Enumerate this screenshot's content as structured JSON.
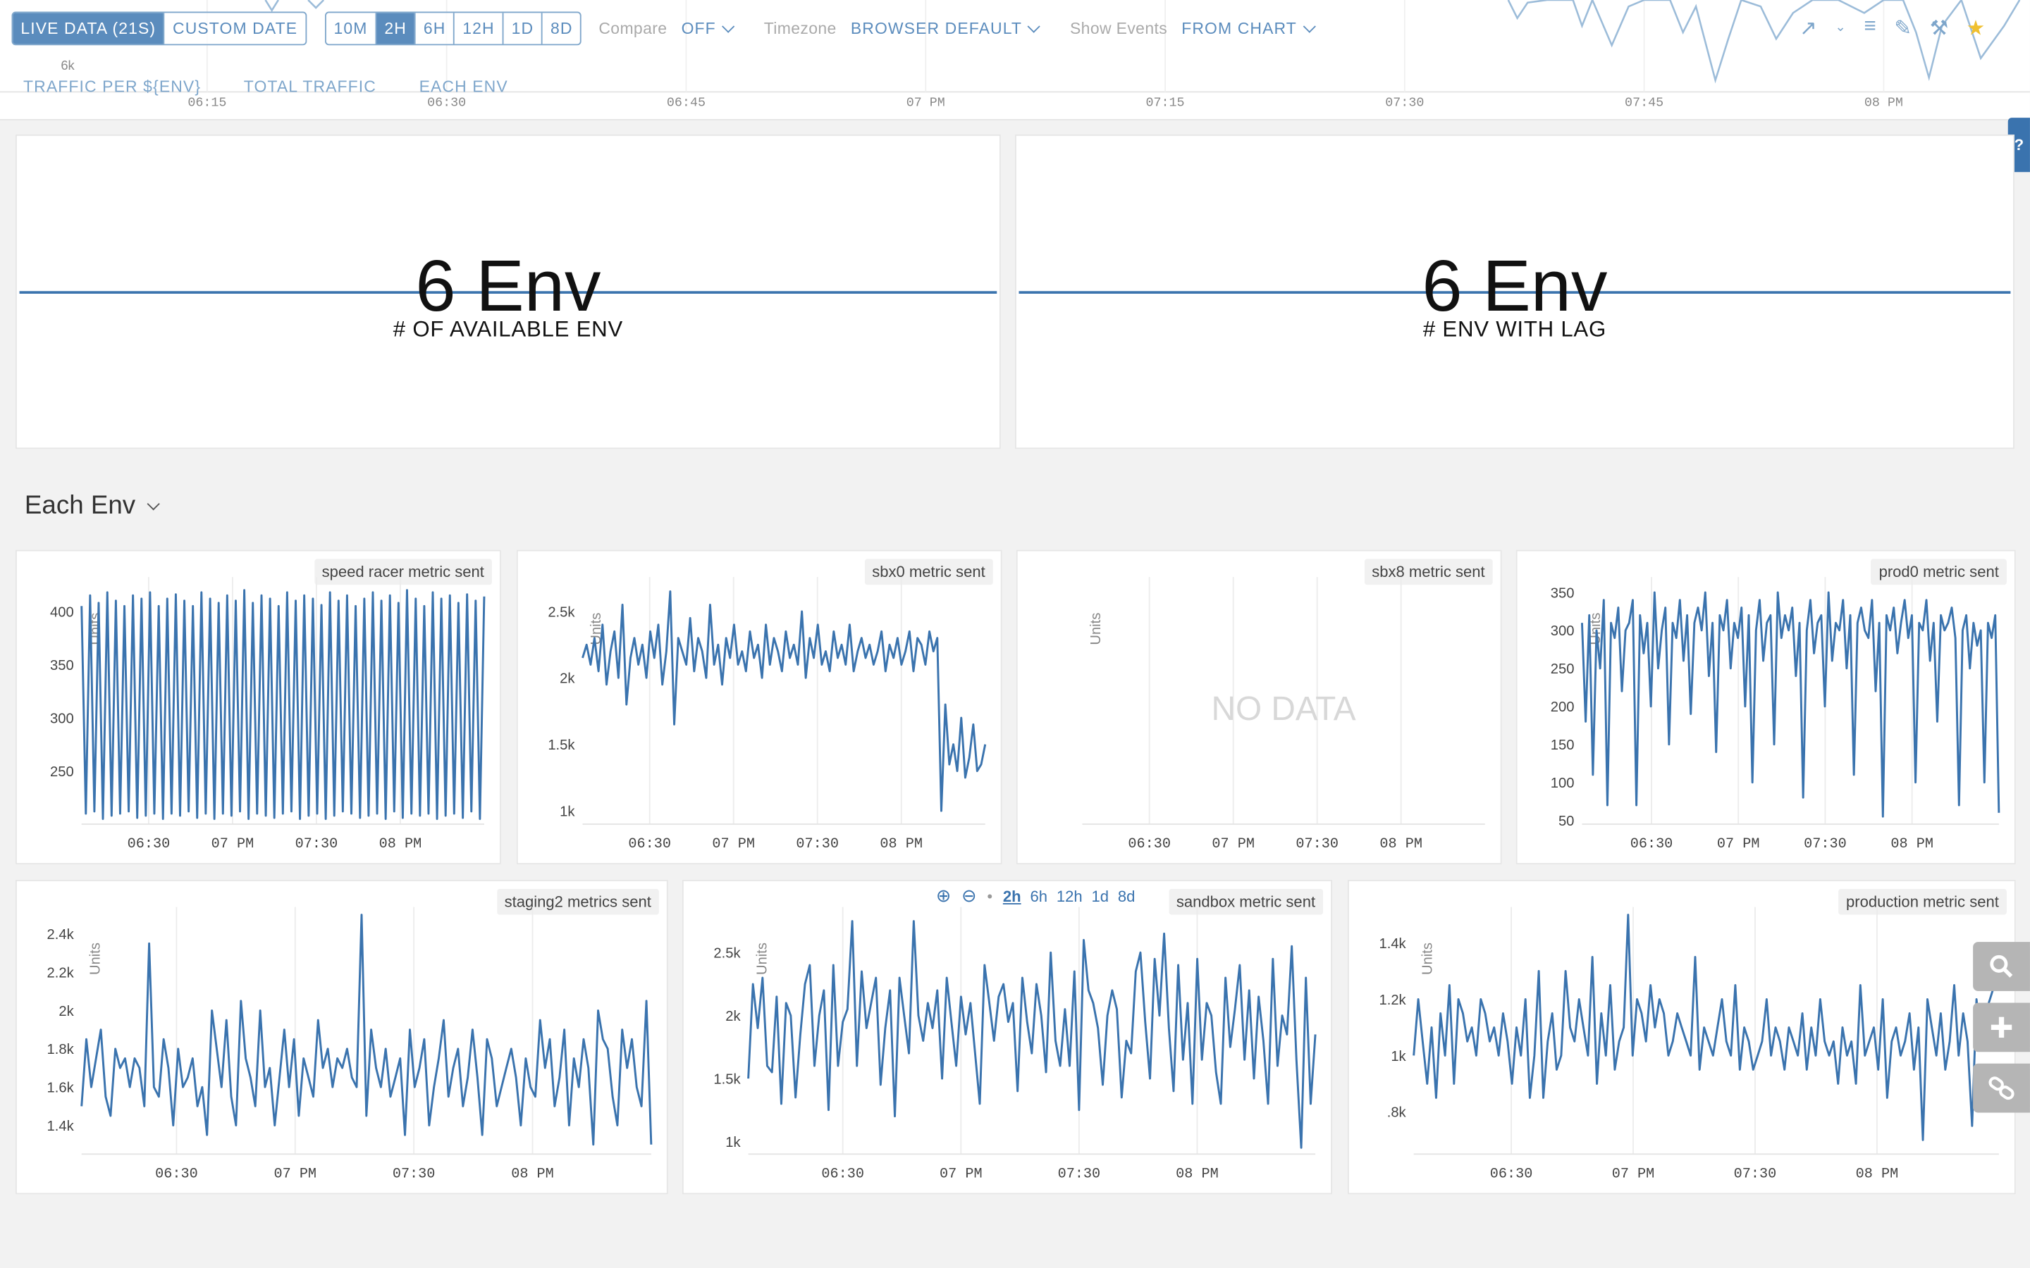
{
  "toolbar": {
    "live_label": "LIVE DATA (21S)",
    "custom_date_label": "CUSTOM DATE",
    "ranges": [
      "10M",
      "2H",
      "6H",
      "12H",
      "1D",
      "8D"
    ],
    "active_range": "2H",
    "compare_label": "Compare",
    "compare_value": "OFF",
    "timezone_label": "Timezone",
    "timezone_value": "BROWSER DEFAULT",
    "events_label": "Show Events",
    "events_value": "FROM CHART"
  },
  "links": [
    "TRAFFIC PER ${ENV}",
    "TOTAL TRAFFIC",
    "EACH ENV"
  ],
  "top_chart": {
    "ytick": "6k",
    "xticks": [
      "06:15",
      "06:30",
      "06:45",
      "07 PM",
      "07:15",
      "07:30",
      "07:45",
      "08 PM"
    ]
  },
  "help_label": "?",
  "stats": [
    {
      "value": "6 Env",
      "label": "# OF AVAILABLE ENV"
    },
    {
      "value": "6 Env",
      "label": "# ENV WITH LAG"
    }
  ],
  "section_title": "Each Env",
  "zoom": {
    "ranges": [
      "2h",
      "6h",
      "12h",
      "1d",
      "8d"
    ],
    "active": "2h"
  },
  "colors": {
    "series": "#3a73ae",
    "accent": "#5b8cbd",
    "grid": "#e8e8e8"
  },
  "chart_data": [
    {
      "type": "line",
      "title": "speed racer metric sent",
      "ylabel": "Units",
      "yticks": [
        {
          "v": 250,
          "t": "250"
        },
        {
          "v": 300,
          "t": "300"
        },
        {
          "v": 350,
          "t": "350"
        },
        {
          "v": 400,
          "t": "400"
        }
      ],
      "ylim": [
        200,
        425
      ],
      "xticks": [
        "06:30",
        "07 PM",
        "07:30",
        "08 PM"
      ],
      "xlim": [
        0,
        120
      ],
      "xtick_pos": [
        20,
        45,
        70,
        95
      ],
      "values": [
        405,
        210,
        415,
        212,
        408,
        205,
        418,
        208,
        410,
        210,
        405,
        212,
        415,
        206,
        412,
        208,
        418,
        210,
        405,
        205,
        412,
        210,
        416,
        208,
        410,
        212,
        405,
        206,
        418,
        210,
        412,
        205,
        408,
        210,
        415,
        208,
        410,
        212,
        420,
        205,
        408,
        210,
        415,
        208,
        412,
        206,
        405,
        210,
        418,
        212,
        410,
        205,
        415,
        208,
        412,
        210,
        406,
        205,
        418,
        208,
        410,
        212,
        415,
        210,
        405,
        206,
        412,
        208,
        418,
        210,
        410,
        205,
        415,
        212,
        408,
        206,
        420,
        210,
        412,
        208,
        405,
        210,
        418,
        205,
        412,
        208,
        415,
        210,
        408,
        206,
        416,
        212,
        410,
        205,
        414
      ],
      "no_data": false
    },
    {
      "type": "line",
      "title": "sbx0 metric sent",
      "ylabel": "Units",
      "yticks": [
        {
          "v": 1000,
          "t": "1k"
        },
        {
          "v": 1500,
          "t": "1.5k"
        },
        {
          "v": 2000,
          "t": "2k"
        },
        {
          "v": 2500,
          "t": "2.5k"
        }
      ],
      "ylim": [
        900,
        2700
      ],
      "xticks": [
        "06:30",
        "07 PM",
        "07:30",
        "08 PM"
      ],
      "xlim": [
        0,
        120
      ],
      "xtick_pos": [
        20,
        45,
        70,
        95
      ],
      "values": [
        2150,
        2250,
        2100,
        2300,
        2050,
        2400,
        1950,
        2200,
        2350,
        2000,
        2550,
        1800,
        2150,
        2300,
        2100,
        2250,
        2000,
        2350,
        2150,
        2400,
        1950,
        2200,
        2650,
        1650,
        2300,
        2200,
        2100,
        2450,
        2050,
        2300,
        2200,
        2000,
        2550,
        2100,
        2250,
        1950,
        2300,
        2150,
        2400,
        2100,
        2200,
        2050,
        2350,
        2150,
        2250,
        2000,
        2400,
        2100,
        2300,
        2200,
        2050,
        2350,
        2150,
        2250,
        2100,
        2500,
        2000,
        2300,
        2150,
        2400,
        2100,
        2200,
        2050,
        2350,
        2150,
        2250,
        2100,
        2400,
        2050,
        2200,
        2300,
        2150,
        2250,
        2100,
        2200,
        2350,
        2050,
        2250,
        2150,
        2300,
        2100,
        2200,
        2350,
        2050,
        2300,
        2250,
        2100,
        2350,
        2200,
        2300,
        1000,
        1800,
        1350,
        1500,
        1300,
        1700,
        1250,
        1400,
        1650,
        1300,
        1350,
        1500
      ],
      "no_data": false
    },
    {
      "type": "line",
      "title": "sbx8 metric sent",
      "ylabel": "Units",
      "yticks": [],
      "ylim": [
        0,
        1
      ],
      "xticks": [
        "06:30",
        "07 PM",
        "07:30",
        "08 PM"
      ],
      "xlim": [
        0,
        120
      ],
      "xtick_pos": [
        20,
        45,
        70,
        95
      ],
      "values": [],
      "no_data": true,
      "no_data_label": "NO DATA"
    },
    {
      "type": "line",
      "title": "prod0 metric sent",
      "ylabel": "Units",
      "yticks": [
        {
          "v": 50,
          "t": "50"
        },
        {
          "v": 100,
          "t": "100"
        },
        {
          "v": 150,
          "t": "150"
        },
        {
          "v": 200,
          "t": "200"
        },
        {
          "v": 250,
          "t": "250"
        },
        {
          "v": 300,
          "t": "300"
        },
        {
          "v": 350,
          "t": "350"
        }
      ],
      "ylim": [
        45,
        360
      ],
      "xticks": [
        "06:30",
        "07 PM",
        "07:30",
        "08 PM"
      ],
      "xlim": [
        0,
        120
      ],
      "xtick_pos": [
        20,
        45,
        70,
        95
      ],
      "values": [
        310,
        180,
        320,
        110,
        300,
        250,
        340,
        70,
        310,
        290,
        330,
        220,
        300,
        310,
        340,
        70,
        320,
        270,
        310,
        200,
        350,
        250,
        300,
        330,
        150,
        310,
        290,
        340,
        260,
        320,
        190,
        310,
        330,
        300,
        350,
        240,
        310,
        140,
        320,
        300,
        340,
        250,
        310,
        290,
        330,
        200,
        320,
        100,
        300,
        340,
        260,
        310,
        320,
        150,
        350,
        290,
        320,
        300,
        330,
        240,
        310,
        80,
        300,
        340,
        270,
        310,
        320,
        200,
        350,
        260,
        310,
        300,
        340,
        250,
        320,
        110,
        310,
        330,
        300,
        290,
        340,
        220,
        310,
        55,
        320,
        300,
        330,
        270,
        310,
        340,
        290,
        320,
        100,
        310,
        300,
        340,
        260,
        310,
        180,
        320,
        300,
        310,
        330,
        290,
        70,
        300,
        320,
        250,
        310,
        280,
        300,
        100,
        310,
        290,
        320,
        60
      ],
      "no_data": false
    },
    {
      "type": "line",
      "title": "staging2 metrics sent",
      "ylabel": "Units",
      "yticks": [
        {
          "v": 1400,
          "t": "1.4k"
        },
        {
          "v": 1600,
          "t": "1.6k"
        },
        {
          "v": 1800,
          "t": "1.8k"
        },
        {
          "v": 2000,
          "t": "2k"
        },
        {
          "v": 2200,
          "t": "2.2k"
        },
        {
          "v": 2400,
          "t": "2.4k"
        }
      ],
      "ylim": [
        1250,
        2500
      ],
      "xticks": [
        "06:30",
        "07 PM",
        "07:30",
        "08 PM"
      ],
      "xlim": [
        0,
        120
      ],
      "xtick_pos": [
        20,
        45,
        70,
        95
      ],
      "values": [
        1500,
        1850,
        1600,
        1750,
        1900,
        1550,
        1450,
        1800,
        1700,
        1750,
        1600,
        1750,
        1700,
        1500,
        2350,
        1600,
        1550,
        1850,
        1700,
        1400,
        1800,
        1600,
        1650,
        1750,
        1500,
        1600,
        1350,
        2000,
        1800,
        1600,
        1950,
        1550,
        1400,
        2050,
        1750,
        1650,
        1500,
        2000,
        1600,
        1700,
        1400,
        1650,
        1900,
        1600,
        1850,
        1450,
        1750,
        1650,
        1550,
        1950,
        1700,
        1800,
        1600,
        1750,
        1700,
        1800,
        1650,
        1600,
        2500,
        1450,
        1900,
        1700,
        1600,
        1800,
        1550,
        1650,
        1750,
        1350,
        1900,
        1600,
        1700,
        1850,
        1400,
        1600,
        1750,
        1950,
        1550,
        1700,
        1800,
        1500,
        1650,
        1900,
        1650,
        1350,
        1850,
        1750,
        1500,
        1600,
        1700,
        1800,
        1650,
        1400,
        1750,
        1600,
        1550,
        1950,
        1700,
        1850,
        1500,
        1650,
        1900,
        1400,
        1750,
        1600,
        1850,
        1700,
        1300,
        2000,
        1850,
        1800,
        1550,
        1400,
        1900,
        1700,
        1850,
        1600,
        1500,
        2050,
        1300
      ],
      "no_data": false
    },
    {
      "type": "line",
      "title": "sandbox metric sent",
      "ylabel": "Units",
      "yticks": [
        {
          "v": 1000,
          "t": "1k"
        },
        {
          "v": 1500,
          "t": "1.5k"
        },
        {
          "v": 2000,
          "t": "2k"
        },
        {
          "v": 2500,
          "t": "2.5k"
        }
      ],
      "ylim": [
        900,
        2800
      ],
      "xticks": [
        "06:30",
        "07 PM",
        "07:30",
        "08 PM"
      ],
      "xlim": [
        0,
        120
      ],
      "xtick_pos": [
        20,
        45,
        70,
        95
      ],
      "values": [
        1500,
        2250,
        1900,
        2300,
        1600,
        1550,
        2150,
        1300,
        2100,
        2000,
        1350,
        1850,
        2250,
        2400,
        1600,
        2000,
        2200,
        1250,
        2400,
        1600,
        1950,
        2050,
        2750,
        1600,
        2350,
        1900,
        2100,
        2300,
        1450,
        1900,
        2200,
        1200,
        2300,
        2000,
        1700,
        2750,
        2000,
        1800,
        2100,
        1900,
        2200,
        1500,
        2300,
        1950,
        1600,
        2150,
        1850,
        2100,
        1700,
        1300,
        2400,
        2100,
        1800,
        2150,
        2250,
        1950,
        2100,
        1400,
        2300,
        1950,
        1700,
        2250,
        2000,
        1550,
        2500,
        1800,
        1600,
        2050,
        1600,
        2350,
        1250,
        2600,
        2200,
        2100,
        1900,
        1450,
        2000,
        2200,
        2050,
        1350,
        1800,
        1700,
        2350,
        2500,
        1950,
        1500,
        2450,
        2000,
        2650,
        1900,
        1400,
        2400,
        1650,
        2100,
        1300,
        2450,
        1650,
        2100,
        2000,
        1550,
        1300,
        2300,
        1750,
        2050,
        2400,
        1650,
        2200,
        1500,
        2150,
        1800,
        1300,
        2450,
        1600,
        2000,
        1850,
        2550,
        1650,
        950,
        2300,
        1300,
        1850
      ],
      "no_data": false
    },
    {
      "type": "line",
      "title": "production metric sent",
      "ylabel": "Units",
      "yticks": [
        {
          "v": 800,
          "t": ".8k"
        },
        {
          "v": 1000,
          "t": "1k"
        },
        {
          "v": 1200,
          "t": "1.2k"
        },
        {
          "v": 1400,
          "t": "1.4k"
        }
      ],
      "ylim": [
        650,
        1500
      ],
      "xticks": [
        "06:30",
        "07 PM",
        "07:30",
        "08 PM"
      ],
      "xlim": [
        0,
        120
      ],
      "xtick_pos": [
        20,
        45,
        70,
        95
      ],
      "values": [
        1000,
        1200,
        1050,
        900,
        1100,
        850,
        1150,
        1000,
        1250,
        900,
        1200,
        1150,
        1050,
        1100,
        1000,
        1200,
        1150,
        1050,
        1100,
        1000,
        1150,
        1050,
        900,
        1100,
        1000,
        1200,
        850,
        1000,
        1300,
        850,
        1050,
        1150,
        950,
        1000,
        1300,
        1100,
        1050,
        1200,
        1100,
        1000,
        1350,
        900,
        1150,
        1000,
        1250,
        950,
        1050,
        1100,
        1500,
        1000,
        1200,
        1150,
        1050,
        1250,
        1100,
        1200,
        1150,
        1000,
        1050,
        1150,
        1100,
        1050,
        1000,
        1350,
        950,
        1100,
        1050,
        1000,
        1100,
        1200,
        1050,
        1000,
        1250,
        950,
        1100,
        1050,
        950,
        1000,
        1050,
        1200,
        1000,
        1100,
        1050,
        950,
        1100,
        1050,
        1000,
        1150,
        950,
        1100,
        1000,
        1200,
        1050,
        1000,
        1050,
        900,
        1100,
        1000,
        1050,
        900,
        1250,
        1000,
        1050,
        1100,
        950,
        1200,
        850,
        1050,
        1100,
        1000,
        1050,
        1150,
        950,
        1100,
        700,
        1200,
        1100,
        1000,
        1150,
        950,
        1050,
        1250,
        1000,
        1150,
        1050,
        750,
        1200,
        1050,
        1150,
        1200,
        1250,
        1300
      ]
    }
  ]
}
